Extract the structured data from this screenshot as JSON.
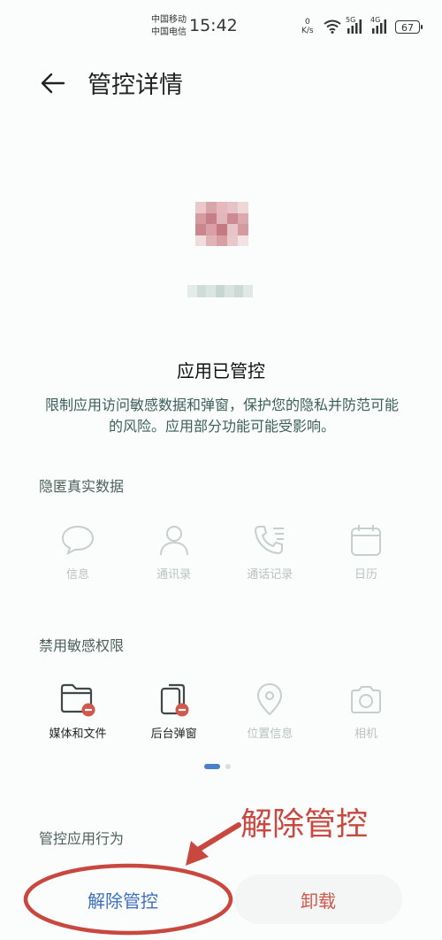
{
  "status_bar": {
    "carrier_1": "中国移动",
    "carrier_2": "中国电信",
    "time": "15:42",
    "net_speed_value": "0",
    "net_speed_unit": "K/s",
    "sig1_tag": "5G",
    "sig2_tag": "4G",
    "battery": "67"
  },
  "header": {
    "title": "管控详情"
  },
  "app": {
    "status_title": "应用已管控",
    "description": "限制应用访问敏感数据和弹窗，保护您的隐私并防范可能的风险。应用部分功能可能受影响。"
  },
  "hidden_data": {
    "label": "隐匿真实数据",
    "items": [
      {
        "label": "信息",
        "icon": "message-icon"
      },
      {
        "label": "通讯录",
        "icon": "contacts-icon"
      },
      {
        "label": "通话记录",
        "icon": "call-log-icon"
      },
      {
        "label": "日历",
        "icon": "calendar-icon"
      }
    ]
  },
  "banned_perms": {
    "label": "禁用敏感权限",
    "items": [
      {
        "label": "媒体和文件",
        "icon": "folder-icon",
        "state": "active"
      },
      {
        "label": "后台弹窗",
        "icon": "popup-icon",
        "state": "active"
      },
      {
        "label": "位置信息",
        "icon": "location-icon",
        "state": "faded"
      },
      {
        "label": "相机",
        "icon": "camera-icon",
        "state": "faded"
      }
    ]
  },
  "behavior": {
    "label": "管控应用行为"
  },
  "buttons": {
    "release": "解除管控",
    "uninstall": "卸载"
  },
  "annotation": {
    "text": "解除管控"
  },
  "colors": {
    "accent_blue": "#3d6fbf",
    "danger_red": "#d2574b",
    "annotation_red": "#c8473f"
  }
}
